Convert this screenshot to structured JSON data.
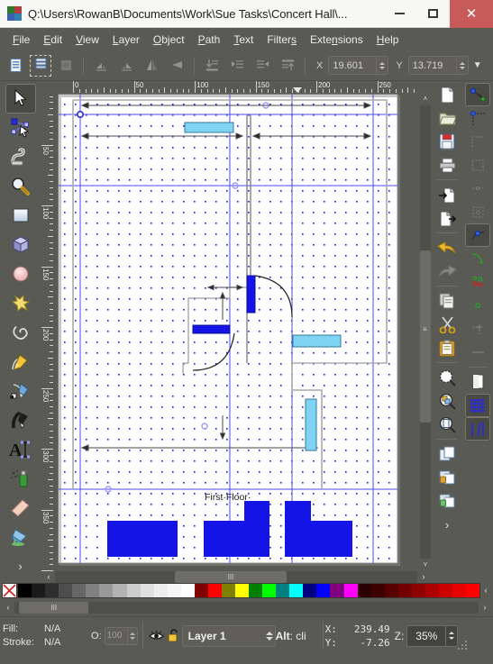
{
  "window": {
    "title": "Q:\\Users\\RowanB\\Documents\\Work\\Sue Tasks\\Concert Hall\\...",
    "app_icon": "inkscape-logo-icon",
    "minimize_label": "Minimize",
    "maximize_label": "Maximize",
    "close_label": "Close",
    "close_color": "#c85a5a"
  },
  "menubar": {
    "items": [
      {
        "label": "File",
        "mnemonic": "F"
      },
      {
        "label": "Edit",
        "mnemonic": "E"
      },
      {
        "label": "View",
        "mnemonic": "V"
      },
      {
        "label": "Layer",
        "mnemonic": "L"
      },
      {
        "label": "Object",
        "mnemonic": "O"
      },
      {
        "label": "Path",
        "mnemonic": "P"
      },
      {
        "label": "Text",
        "mnemonic": "T"
      },
      {
        "label": "Filters",
        "mnemonic": "s"
      },
      {
        "label": "Extensions",
        "mnemonic": "n"
      },
      {
        "label": "Help",
        "mnemonic": "H"
      }
    ]
  },
  "command_toolbar": {
    "buttons": [
      {
        "name": "select-all-icon",
        "label": "Select All",
        "enabled": true,
        "selected": false
      },
      {
        "name": "select-all-layers-icon",
        "label": "Select All in All Layers",
        "enabled": true,
        "selected": true
      },
      {
        "name": "deselect-icon",
        "label": "Deselect",
        "enabled": false,
        "selected": false
      },
      {
        "name": "rotate-90-ccw-icon",
        "label": "Rotate 90° CCW",
        "enabled": false,
        "selected": false
      },
      {
        "name": "rotate-90-cw-icon",
        "label": "Rotate 90° CW",
        "enabled": false,
        "selected": false
      },
      {
        "name": "flip-horizontal-icon",
        "label": "Flip Horizontal",
        "enabled": false,
        "selected": false
      },
      {
        "name": "flip-vertical-icon",
        "label": "Flip Vertical",
        "enabled": false,
        "selected": false
      },
      {
        "name": "lower-to-bottom-icon",
        "label": "Lower to Bottom",
        "enabled": false,
        "selected": false
      },
      {
        "name": "lower-icon",
        "label": "Lower",
        "enabled": false,
        "selected": false
      },
      {
        "name": "raise-icon",
        "label": "Raise",
        "enabled": false,
        "selected": false
      },
      {
        "name": "raise-to-top-icon",
        "label": "Raise to Top",
        "enabled": false,
        "selected": false
      }
    ],
    "x_label": "X",
    "x_value": "19.601",
    "y_label": "Y",
    "y_value": "13.719",
    "overflow_label": "More"
  },
  "left_toolbox": {
    "tools": [
      {
        "name": "selector-tool",
        "label": "Selector",
        "active": true
      },
      {
        "name": "node-tool",
        "label": "Node Editor",
        "active": false
      },
      {
        "name": "tweak-tool",
        "label": "Tweak",
        "active": false
      },
      {
        "name": "zoom-tool",
        "label": "Zoom",
        "active": false
      },
      {
        "name": "rectangle-tool",
        "label": "Rectangle",
        "active": false
      },
      {
        "name": "3dbox-tool",
        "label": "3D Box",
        "active": false
      },
      {
        "name": "ellipse-tool",
        "label": "Ellipse",
        "active": false
      },
      {
        "name": "star-tool",
        "label": "Star",
        "active": false
      },
      {
        "name": "spiral-tool",
        "label": "Spiral",
        "active": false
      },
      {
        "name": "pencil-tool",
        "label": "Pencil",
        "active": false
      },
      {
        "name": "bezier-tool",
        "label": "Bezier / Pen",
        "active": false
      },
      {
        "name": "calligraphy-tool",
        "label": "Calligraphy",
        "active": false
      },
      {
        "name": "text-tool",
        "label": "Text",
        "active": false
      },
      {
        "name": "spray-tool",
        "label": "Spray",
        "active": false
      },
      {
        "name": "eraser-tool",
        "label": "Eraser",
        "active": false
      },
      {
        "name": "paint-bucket-tool",
        "label": "Paint Bucket",
        "active": false
      }
    ],
    "overflow_label": "›"
  },
  "right_toolbox_outer": {
    "buttons": [
      {
        "name": "new-document-icon",
        "label": "New"
      },
      {
        "name": "open-document-icon",
        "label": "Open"
      },
      {
        "name": "save-document-icon",
        "label": "Save"
      },
      {
        "name": "print-document-icon",
        "label": "Print"
      },
      {
        "name": "import-icon",
        "label": "Import"
      },
      {
        "name": "export-icon",
        "label": "Export PNG"
      },
      {
        "name": "undo-icon",
        "label": "Undo"
      },
      {
        "name": "redo-icon",
        "label": "Redo"
      },
      {
        "name": "copy-icon",
        "label": "Copy"
      },
      {
        "name": "cut-icon",
        "label": "Cut"
      },
      {
        "name": "paste-icon",
        "label": "Paste"
      },
      {
        "name": "zoom-selection-icon",
        "label": "Zoom Selection"
      },
      {
        "name": "zoom-drawing-icon",
        "label": "Zoom Drawing"
      },
      {
        "name": "zoom-page-icon",
        "label": "Zoom Page"
      },
      {
        "name": "duplicate-icon",
        "label": "Duplicate"
      },
      {
        "name": "group-icon",
        "label": "Group"
      },
      {
        "name": "ungroup-icon",
        "label": "Ungroup"
      }
    ],
    "overflow_label": "›"
  },
  "right_toolbox_inner": {
    "buttons": [
      {
        "name": "snap-enable-icon",
        "label": "Enable Snapping",
        "active": true
      },
      {
        "name": "snap-bounding-box-icon",
        "label": "Snap Bounding Box"
      },
      {
        "name": "snap-bbox-corner-icon",
        "label": "Snap BBox Corner"
      },
      {
        "name": "snap-bbox-edge-icon",
        "label": "Snap BBox Edge"
      },
      {
        "name": "snap-bbox-midpoint-icon",
        "label": "Snap BBox Midpoint"
      },
      {
        "name": "snap-bbox-center-icon",
        "label": "Snap BBox Center"
      },
      {
        "name": "snap-nodes-icon",
        "label": "Snap Nodes / Paths",
        "active": true
      },
      {
        "name": "snap-path-icon",
        "label": "Snap to Paths"
      },
      {
        "name": "snap-path-intersection-icon",
        "label": "Snap Path Intersections"
      },
      {
        "name": "snap-cusp-node-icon",
        "label": "Snap Cusp Nodes"
      },
      {
        "name": "snap-smooth-node-icon",
        "label": "Snap Smooth Nodes"
      },
      {
        "name": "snap-object-midpoint-icon",
        "label": "Snap Midpoints"
      },
      {
        "name": "snap-object-rotation-center-icon",
        "label": "Snap Rotation Center"
      },
      {
        "name": "snap-page-border-icon",
        "label": "Snap Page Border"
      },
      {
        "name": "snap-grid-icon",
        "label": "Snap to Grid",
        "active": true
      },
      {
        "name": "snap-guide-icon",
        "label": "Snap to Guides",
        "active": true
      }
    ]
  },
  "rulers": {
    "horizontal_ticks": [
      "0",
      "50",
      "100",
      "150",
      "200",
      "250",
      "3"
    ],
    "vertical_ticks": [
      "50",
      "100",
      "150",
      "200",
      "250",
      "300",
      "350"
    ],
    "unit": "px"
  },
  "canvas": {
    "drawing_title": "First Floor",
    "zoom_cursor_icon": "zoom-cursor-icon",
    "grid_dot_color": "#1818ee",
    "guide_color": "#4949ff",
    "page_border_color": "#000000",
    "wall_color": "#1414e6",
    "window_fill_color": "#7fd4f4",
    "door_fill_color": "#1414e6",
    "dimension_line_color": "#555555"
  },
  "scrollbars": {
    "horizontal_left_label": "‹",
    "horizontal_right_label": "›",
    "horizontal_thumb_label": "III",
    "vertical_up_label": "˄",
    "vertical_down_label": "˅",
    "vertical_thumb_label": "≡",
    "strip_left_label": "‹",
    "strip_right_label": "›",
    "strip_thumb_label": "III"
  },
  "palette": {
    "left_label": "X",
    "right_label": "‹",
    "swatches": [
      "#000000",
      "#1a1a1a",
      "#2e2e2e",
      "#4d4d4d",
      "#666666",
      "#808080",
      "#999999",
      "#b3b3b3",
      "#cccccc",
      "#e0e0e0",
      "#ededed",
      "#f5f5f5",
      "#ffffff",
      "#800000",
      "#ff0000",
      "#808000",
      "#ffff00",
      "#008000",
      "#00ff00",
      "#008080",
      "#00ffff",
      "#000080",
      "#0000ff",
      "#800080",
      "#ff00ff",
      "#2b0000",
      "#3d0000",
      "#560000",
      "#730000",
      "#8f0000",
      "#ad0000",
      "#cc0000",
      "#e60000",
      "#ff0000"
    ]
  },
  "status_bar": {
    "fill_label": "Fill:",
    "fill_value": "N/A",
    "stroke_label": "Stroke:",
    "stroke_value": "N/A",
    "opacity_label": "O:",
    "opacity_value": "100",
    "layer_visibility_icon": "eye-icon",
    "layer_lock_icon": "unlocked-padlock-icon",
    "layer_name": "Layer 1",
    "hint_prefix": "Alt",
    "hint_text": ": cli",
    "x_label": "X:",
    "x_value": "239.49",
    "y_label": "Y:",
    "y_value": "-7.26",
    "zoom_label": "Z:",
    "zoom_value": "35%"
  }
}
